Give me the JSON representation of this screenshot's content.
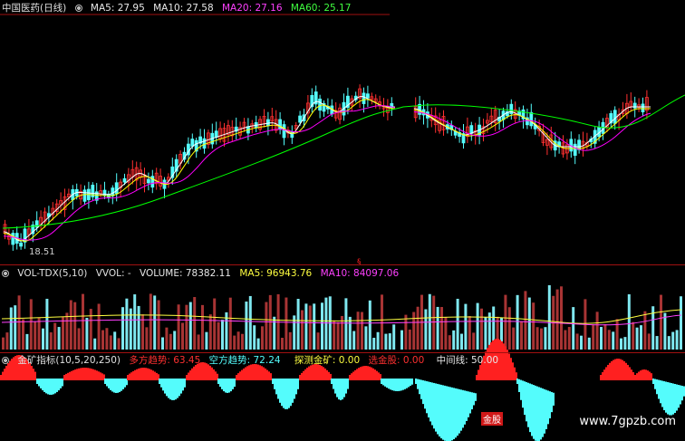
{
  "main_panel": {
    "stock_name": "中国医药(日线)",
    "ma5": "MA5: 27.95",
    "ma10": "MA10: 27.58",
    "ma20": "MA20: 27.16",
    "ma60": "MA60: 25.17",
    "low_label": "18.51",
    "colors": {
      "up": "#ff3030",
      "down": "#54fcfc",
      "ma5": "#ffffff",
      "ma10": "#ffff00",
      "ma20": "#ff00ff",
      "ma60": "#00ff00"
    }
  },
  "volume_panel": {
    "title": "VOL-TDX(5,10)",
    "vvol": "VVOL: -",
    "volume": "VOLUME: 78382.11",
    "ma5": "MA5: 96943.76",
    "ma10": "MA10: 84097.06"
  },
  "indicator_panel": {
    "title": "金矿指标(10,5,20,250)",
    "long_trend": "多方趋势: 63.45",
    "short_trend": "空方趋势: 72.24",
    "probe": "探测金矿: 0.00",
    "select_stock": "选金股: 0.00",
    "mid_line": "中间线: 50.00",
    "signal_label": "金股"
  },
  "marker": "§",
  "watermark": "www.7gpzb.com"
}
